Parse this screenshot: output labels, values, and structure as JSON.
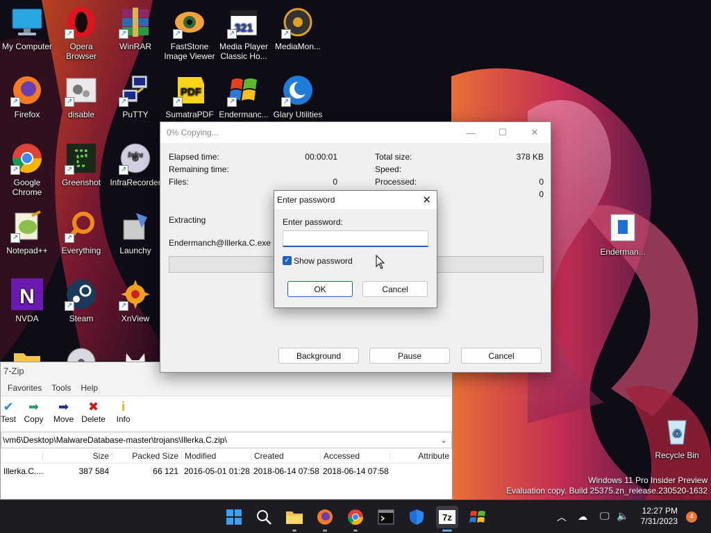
{
  "desktop": {
    "icons": [
      {
        "label": "My Computer",
        "icon": "computer-icon"
      },
      {
        "label": "Opera Browser",
        "icon": "opera-icon"
      },
      {
        "label": "WinRAR",
        "icon": "winrar-icon"
      },
      {
        "label": "FastStone Image Viewer",
        "icon": "faststone-icon"
      },
      {
        "label": "Media Player Classic Ho...",
        "icon": "mpc-icon"
      },
      {
        "label": "MediaMon...",
        "icon": "mediamonkey-icon"
      },
      {
        "label": "Firefox",
        "icon": "firefox-icon"
      },
      {
        "label": "disable",
        "icon": "settings-file-icon"
      },
      {
        "label": "PuTTY",
        "icon": "putty-icon"
      },
      {
        "label": "SumatraPDF",
        "icon": "pdf-icon"
      },
      {
        "label": "Endermanc...",
        "icon": "windows-xp-icon"
      },
      {
        "label": "Glary Utilities",
        "icon": "glary-icon"
      },
      {
        "label": "Google Chrome",
        "icon": "chrome-icon"
      },
      {
        "label": "Greenshot",
        "icon": "greenshot-icon"
      },
      {
        "label": "InfraRecorder",
        "icon": "infrarecorder-icon"
      },
      {
        "label": "Notepad++",
        "icon": "notepadpp-icon"
      },
      {
        "label": "Everything",
        "icon": "everything-icon"
      },
      {
        "label": "Launchy",
        "icon": "launchy-icon"
      },
      {
        "label": "NVDA",
        "icon": "nvda-icon"
      },
      {
        "label": "Steam",
        "icon": "steam-icon"
      },
      {
        "label": "XnView",
        "icon": "xnview-icon"
      },
      {
        "label": "Enderman...",
        "icon": "document-icon"
      },
      {
        "label": "Recycle Bin",
        "icon": "recycle-bin-icon"
      }
    ]
  },
  "zip_window": {
    "title": "7-Zip",
    "menu": [
      "Favorites",
      "Tools",
      "Help"
    ],
    "toolbar": [
      "Test",
      "Copy",
      "Move",
      "Delete",
      "Info"
    ],
    "address": "\\vm6\\Desktop\\MalwareDatabase-master\\trojans\\Illerka.C.zip\\",
    "columns": [
      "Size",
      "Packed Size",
      "Modified",
      "Created",
      "Accessed",
      "Attribute"
    ],
    "row": {
      "name": "Illerka.C....",
      "size": "387 584",
      "packed": "66 121",
      "modified": "2016-05-01 01:28",
      "created": "2018-06-14 07:58",
      "accessed": "2018-06-14 07:58"
    }
  },
  "copy_dialog": {
    "title": "0% Copying...",
    "elapsed_label": "Elapsed time:",
    "elapsed_value": "00:00:01",
    "remaining_label": "Remaining time:",
    "files_label": "Files:",
    "files_value": "0",
    "total_label": "Total size:",
    "total_value": "378 KB",
    "speed_label": "Speed:",
    "processed_label": "Processed:",
    "processed_value": "0",
    "extra_value": "0",
    "action": "Extracting",
    "filename": "Endermanch@Illerka.C.exe",
    "progress": 0,
    "buttons": {
      "background": "Background",
      "pause": "Pause",
      "cancel": "Cancel"
    }
  },
  "password_dialog": {
    "title": "Enter password",
    "field_label": "Enter password:",
    "value": "",
    "show_password_label": "Show password",
    "show_password_checked": true,
    "ok": "OK",
    "cancel": "Cancel"
  },
  "watermark": {
    "line1": "Windows 11 Pro Insider Preview",
    "line2": "Evaluation copy. Build 25375.zn_release.230520-1632"
  },
  "taskbar": {
    "apps": [
      "start-icon",
      "search-icon",
      "file-explorer-icon",
      "firefox-icon",
      "chrome-icon",
      "terminal-icon",
      "defender-icon",
      "7zip-icon",
      "windows-xp-icon"
    ],
    "time": "12:27 PM",
    "date": "7/31/2023",
    "notifications": "4"
  }
}
